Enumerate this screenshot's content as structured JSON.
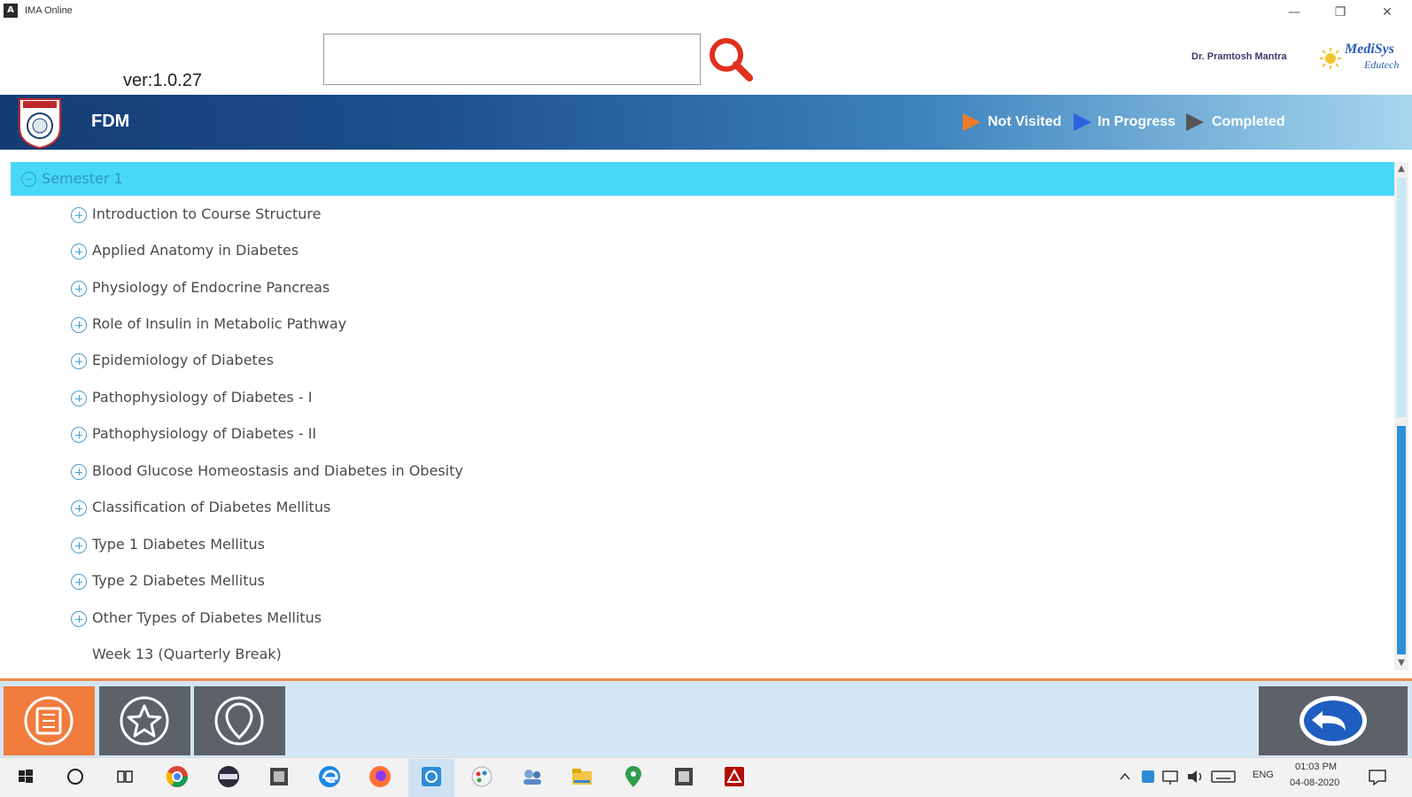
{
  "window": {
    "title": "IMA Online",
    "minimize": "—",
    "maximize": "❐",
    "close": "✕"
  },
  "header": {
    "version": "ver:1.0.27",
    "search_value": "",
    "user_name": "Dr. Pramtosh Mantra",
    "brand_line1": "MediSys",
    "brand_line2": "Edutech"
  },
  "banner": {
    "course_title": "FDM",
    "legend": [
      {
        "label": "Not Visited",
        "color": "#f07a25"
      },
      {
        "label": "In Progress",
        "color": "#2a62e0"
      },
      {
        "label": "Completed",
        "color": "#555555"
      }
    ]
  },
  "tree": {
    "semester": "Semester 1",
    "topics": [
      "Introduction to Course Structure",
      "Applied Anatomy in Diabetes",
      "Physiology of Endocrine Pancreas",
      "Role of Insulin in Metabolic Pathway",
      "Epidemiology of Diabetes",
      "Pathophysiology of Diabetes - I",
      "Pathophysiology of Diabetes - II",
      "Blood Glucose Homeostasis and Diabetes in Obesity",
      "Classification of Diabetes Mellitus",
      "Type 1 Diabetes Mellitus",
      "Type 2 Diabetes Mellitus",
      "Other Types of Diabetes Mellitus"
    ],
    "break_item": "Week 13 (Quarterly Break)"
  },
  "toolbar": {
    "buttons": [
      "book-icon",
      "star-icon",
      "location-pin-icon"
    ],
    "back": "back-arrow-icon"
  },
  "taskbar": {
    "language": "ENG",
    "time": "01:03 PM",
    "date": "04-08-2020"
  },
  "colors": {
    "accent_cyan": "#47d8f7",
    "banner_dark": "#143c73",
    "orange": "#f07c3e",
    "toolbar_gray": "#5d6168"
  }
}
